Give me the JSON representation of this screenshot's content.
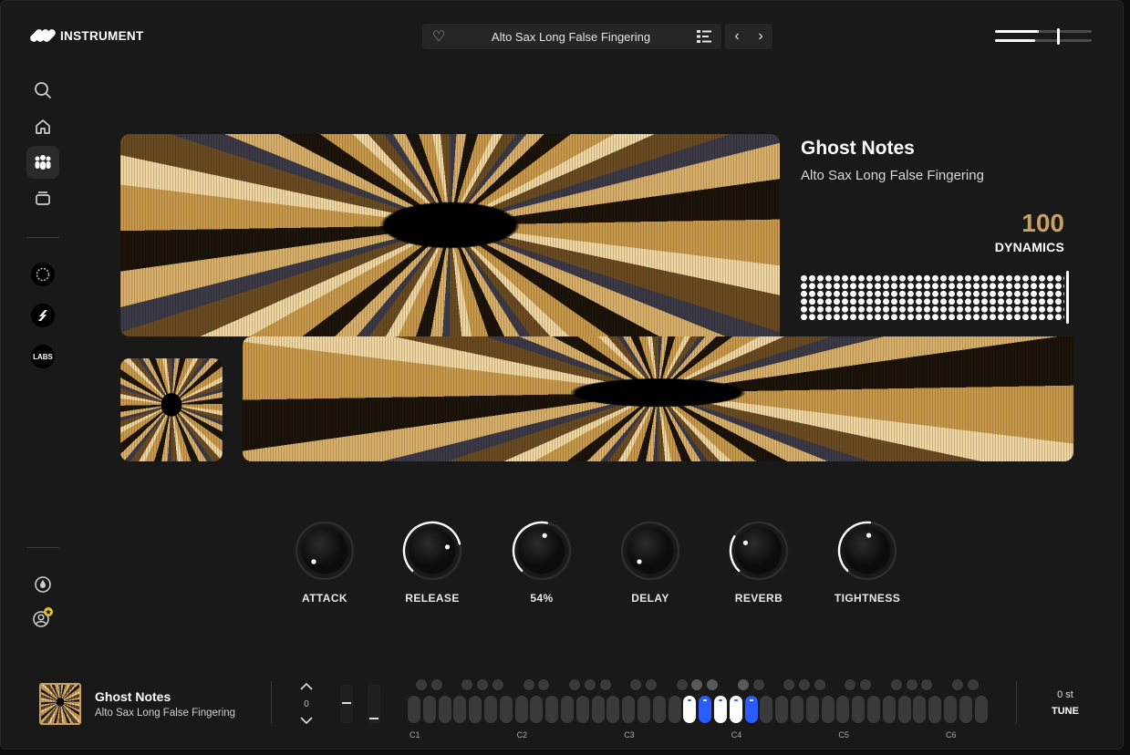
{
  "app": {
    "logo_text": "INSTRUMENT"
  },
  "header": {
    "preset_name": "Alto Sax Long False Fingering",
    "volume_level": 0.64
  },
  "sidebar": {
    "items": [
      {
        "name": "search",
        "icon": "search-icon"
      },
      {
        "name": "home",
        "icon": "home-icon"
      },
      {
        "name": "instruments",
        "icon": "instruments-icon",
        "active": true
      },
      {
        "name": "library",
        "icon": "library-icon"
      }
    ],
    "brands": [
      "ring-logo",
      "s-logo"
    ],
    "labs_label": "LABS",
    "bottom": [
      {
        "name": "drop",
        "icon": "drop-icon"
      },
      {
        "name": "account",
        "icon": "user-icon"
      }
    ]
  },
  "instrument": {
    "title": "Ghost Notes",
    "subtitle": "Alto Sax Long False Fingering",
    "dynamics_value": "100",
    "dynamics_label": "DYNAMICS"
  },
  "knobs": [
    {
      "label": "ATTACK",
      "value": 0.0
    },
    {
      "label": "RELEASE",
      "value": 0.78
    },
    {
      "label": "54%",
      "value": 0.54
    },
    {
      "label": "DELAY",
      "value": 0.0
    },
    {
      "label": "REVERB",
      "value": 0.28
    },
    {
      "label": "TIGHTNESS",
      "value": 0.52
    }
  ],
  "footer": {
    "title": "Ghost Notes",
    "subtitle": "Alto Sax Long False Fingering",
    "octave_value": "0",
    "octave_labels": [
      "C1",
      "C2",
      "C3",
      "C4",
      "C5",
      "C6"
    ],
    "tune_value": "0 st",
    "tune_label": "TUNE"
  },
  "colors": {
    "accent_gold": "#c9a060",
    "key_active_blue": "#2b5cff",
    "background": "#191919"
  }
}
